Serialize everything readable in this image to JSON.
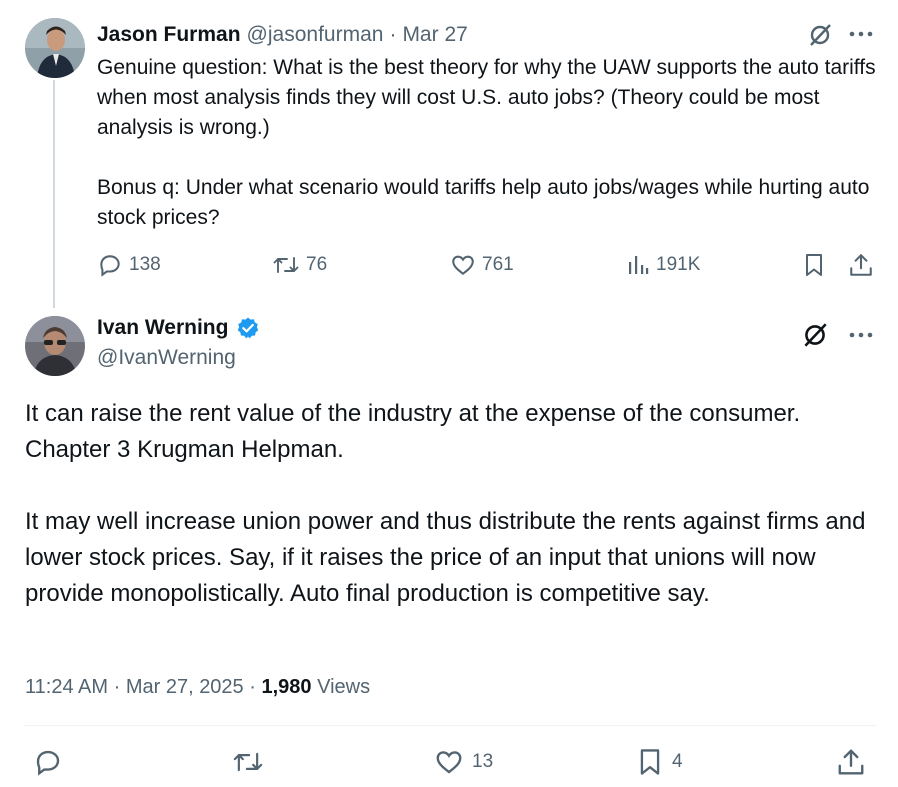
{
  "parent_tweet": {
    "author_name": "Jason Furman",
    "author_handle": "@jasonfurman",
    "separator": "·",
    "date": "Mar 27",
    "text": "Genuine question: What is the best theory for why the UAW supports the auto tariffs when most analysis finds they will cost U.S. auto jobs? (Theory could be most analysis is wrong.)\n\nBonus q: Under what scenario would tariffs help auto jobs/wages while hurting auto stock prices?",
    "actions": {
      "replies": "138",
      "reposts": "76",
      "likes": "761",
      "views": "191K"
    }
  },
  "reply_tweet": {
    "author_name": "Ivan Werning",
    "author_handle": "@IvanWerning",
    "verified": true,
    "text": "It can raise the rent value of the industry at the expense of the consumer. Chapter 3 Krugman Helpman.\n\nIt may well increase union power and thus distribute the rents against firms and lower stock prices. Say, if it raises the price of an input that unions will now provide monopolistically. Auto final production is competitive say.",
    "time": "11:24 AM",
    "date": "Mar 27, 2025",
    "views_count": "1,980",
    "views_label": "Views",
    "actions": {
      "likes": "13",
      "bookmarks": "4"
    }
  },
  "colors": {
    "text": "#0f1419",
    "muted": "#536471",
    "verified": "#1d9bf0",
    "line": "#cfd9de"
  }
}
